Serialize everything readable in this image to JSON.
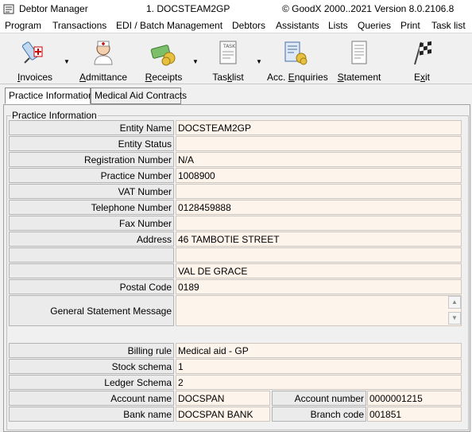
{
  "titlebar": {
    "app_name": "Debtor Manager",
    "doc_name": "1. DOCSTEAM2GP",
    "version": "© GoodX 2000..2021  Version 8.0.2106.8"
  },
  "menu": [
    "Program",
    "Transactions",
    "EDI / Batch Management",
    "Debtors",
    "Assistants",
    "Lists",
    "Queries",
    "Print",
    "Task list"
  ],
  "toolbar": {
    "items": [
      {
        "pre": "",
        "u": "I",
        "post": "nvoices",
        "icon": "syringe-icon"
      },
      {
        "pre": "",
        "u": "A",
        "post": "dmittance",
        "icon": "nurse-icon"
      },
      {
        "pre": "",
        "u": "R",
        "post": "eceipts",
        "icon": "money-icon"
      },
      {
        "pre": "Tas",
        "u": "k",
        "post": "list",
        "icon": "tasklist-icon"
      },
      {
        "pre": "Acc. ",
        "u": "E",
        "post": "nquiries",
        "icon": "enquiries-icon"
      },
      {
        "pre": "",
        "u": "S",
        "post": "tatement",
        "icon": "statement-icon"
      },
      {
        "pre": "E",
        "u": "x",
        "post": "it",
        "icon": "exit-flag-icon"
      }
    ]
  },
  "tabs": [
    "Practice Information",
    "Medical Aid Contracts"
  ],
  "group_title": "Practice Information",
  "fields": [
    {
      "label": "Entity Name",
      "value": "DOCSTEAM2GP"
    },
    {
      "label": "Entity Status",
      "value": ""
    },
    {
      "label": "Registration Number",
      "value": "N/A"
    },
    {
      "label": "Practice Number",
      "value": "1008900"
    },
    {
      "label": "VAT Number",
      "value": ""
    },
    {
      "label": "Telephone Number",
      "value": "0128459888"
    },
    {
      "label": "Fax Number",
      "value": ""
    },
    {
      "label": "Address",
      "value": "46 TAMBOTIE STREET"
    },
    {
      "label": "",
      "value": ""
    },
    {
      "label": "",
      "value": "VAL DE GRACE"
    },
    {
      "label": "Postal Code",
      "value": "0189"
    }
  ],
  "statement_message": {
    "label": "General Statement Message",
    "value": ""
  },
  "billing": [
    {
      "label": "Billing rule",
      "value": "Medical aid - GP"
    },
    {
      "label": "Stock schema",
      "value": "1"
    },
    {
      "label": "Ledger Schema",
      "value": "2"
    }
  ],
  "bank": {
    "account_name_label": "Account name",
    "account_name": "DOCSPAN",
    "account_number_label": "Account number",
    "account_number": "0000001215",
    "bank_name_label": "Bank name",
    "bank_name": "DOCSPAN BANK",
    "branch_code_label": "Branch code",
    "branch_code": "001851"
  }
}
